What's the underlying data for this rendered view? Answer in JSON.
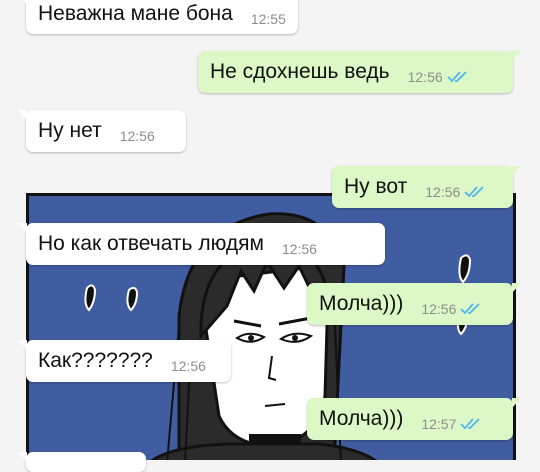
{
  "colors": {
    "incoming_bubble": "#ffffff",
    "outgoing_bubble": "#dcf8c6",
    "read_ticks": "#4fb6ec",
    "timestamp": "#8d8d8d",
    "comic_background": "#3f5da0"
  },
  "messages": [
    {
      "direction": "in",
      "text": "Неважна мане бона",
      "time": "12:55"
    },
    {
      "direction": "out",
      "text": "Не сдохнешь ведь",
      "time": "12:56",
      "status_icon": "double-check-icon"
    },
    {
      "direction": "in",
      "text": "Ну нет",
      "time": "12:56"
    },
    {
      "direction": "out",
      "text": "Ну вот",
      "time": "12:56",
      "status_icon": "double-check-icon"
    },
    {
      "direction": "in",
      "text": "Но как отвечать людям",
      "time": "12:56"
    },
    {
      "direction": "out",
      "text": "Молча)))",
      "time": "12:56",
      "status_icon": "double-check-icon"
    },
    {
      "direction": "in",
      "text": "Как???????",
      "time": "12:56"
    },
    {
      "direction": "out",
      "text": "Молча)))",
      "time": "12:57",
      "status_icon": "double-check-icon"
    }
  ]
}
